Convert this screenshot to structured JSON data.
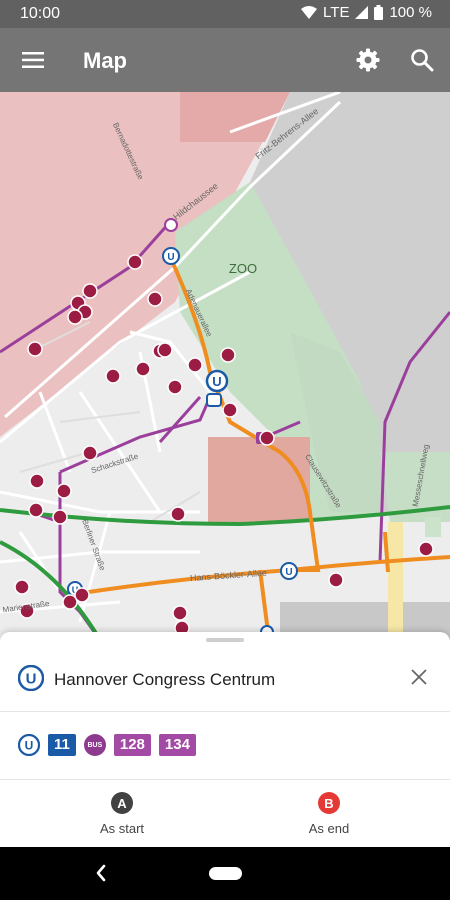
{
  "status_bar": {
    "time": "10:00",
    "network": "LTE",
    "battery": "100 %"
  },
  "app_bar": {
    "title": "Map"
  },
  "map": {
    "labels": {
      "zoo": "ZOO",
      "street_chaussee": "Hildchaussee",
      "street_fritz": "Fritz-Behrens-Allee",
      "street_zoo": "Adenauerallee",
      "street_bockler": "Hans-Böckler-Allee",
      "street_messe": "Messeschnellweg",
      "street_schack": "Schackstraße",
      "street_clausewitz": "Clausewitzstraße",
      "street_marien": "Marienstraße",
      "street_platz": "Berliner Straße",
      "street_celle": "Bernadottestraße"
    }
  },
  "stop": {
    "name": "Hannover Congress Centrum",
    "mode_letter": "U"
  },
  "lines": {
    "u_letter": "U",
    "items": [
      {
        "label": "11",
        "color": "#1a5aa6"
      },
      {
        "label": "BUS",
        "color": "#8e3b8f"
      },
      {
        "label": "128",
        "color": "#a34aa4"
      },
      {
        "label": "134",
        "color": "#a34aa4"
      }
    ]
  },
  "actions": {
    "start": {
      "letter": "A",
      "label": "As start",
      "color": "#424242"
    },
    "end": {
      "letter": "B",
      "label": "As end",
      "color": "#e53935"
    }
  }
}
